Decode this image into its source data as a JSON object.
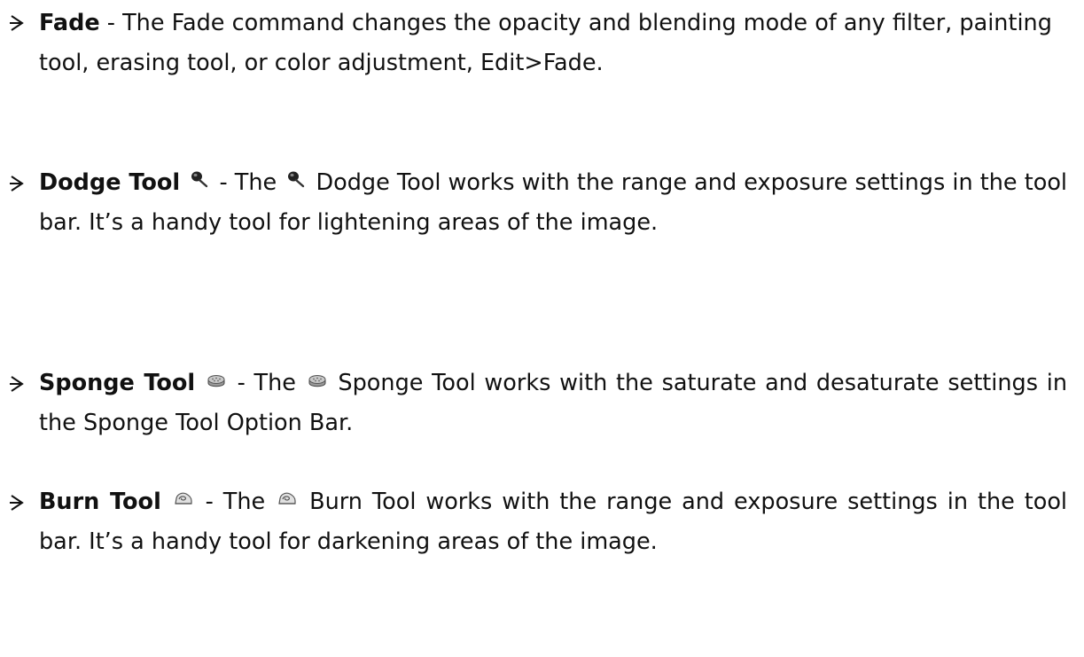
{
  "items": [
    {
      "term": "Fade",
      "description": " - The Fade command changes the opacity and blending mode of any filter, painting tool, erasing tool, or color adjustment, Edit>Fade."
    },
    {
      "term": "Dodge Tool",
      "icon": "dodge-tool-icon",
      "description_part1": " - The ",
      "description_part2": " Dodge Tool works with the range and exposure settings in the tool bar. It’s a handy tool for lightening areas of the image."
    },
    {
      "term": "Sponge Tool",
      "icon": "sponge-tool-icon",
      "description_part1": " - The ",
      "description_part2": " Sponge Tool works with the saturate and desaturate settings in the Sponge Tool Option Bar."
    },
    {
      "term": "Burn Tool",
      "icon": "burn-tool-icon",
      "description_part1": " - The ",
      "description_part2": " Burn Tool works with the range and exposure settings in the tool bar. It’s a handy tool for darkening areas of the image."
    }
  ]
}
